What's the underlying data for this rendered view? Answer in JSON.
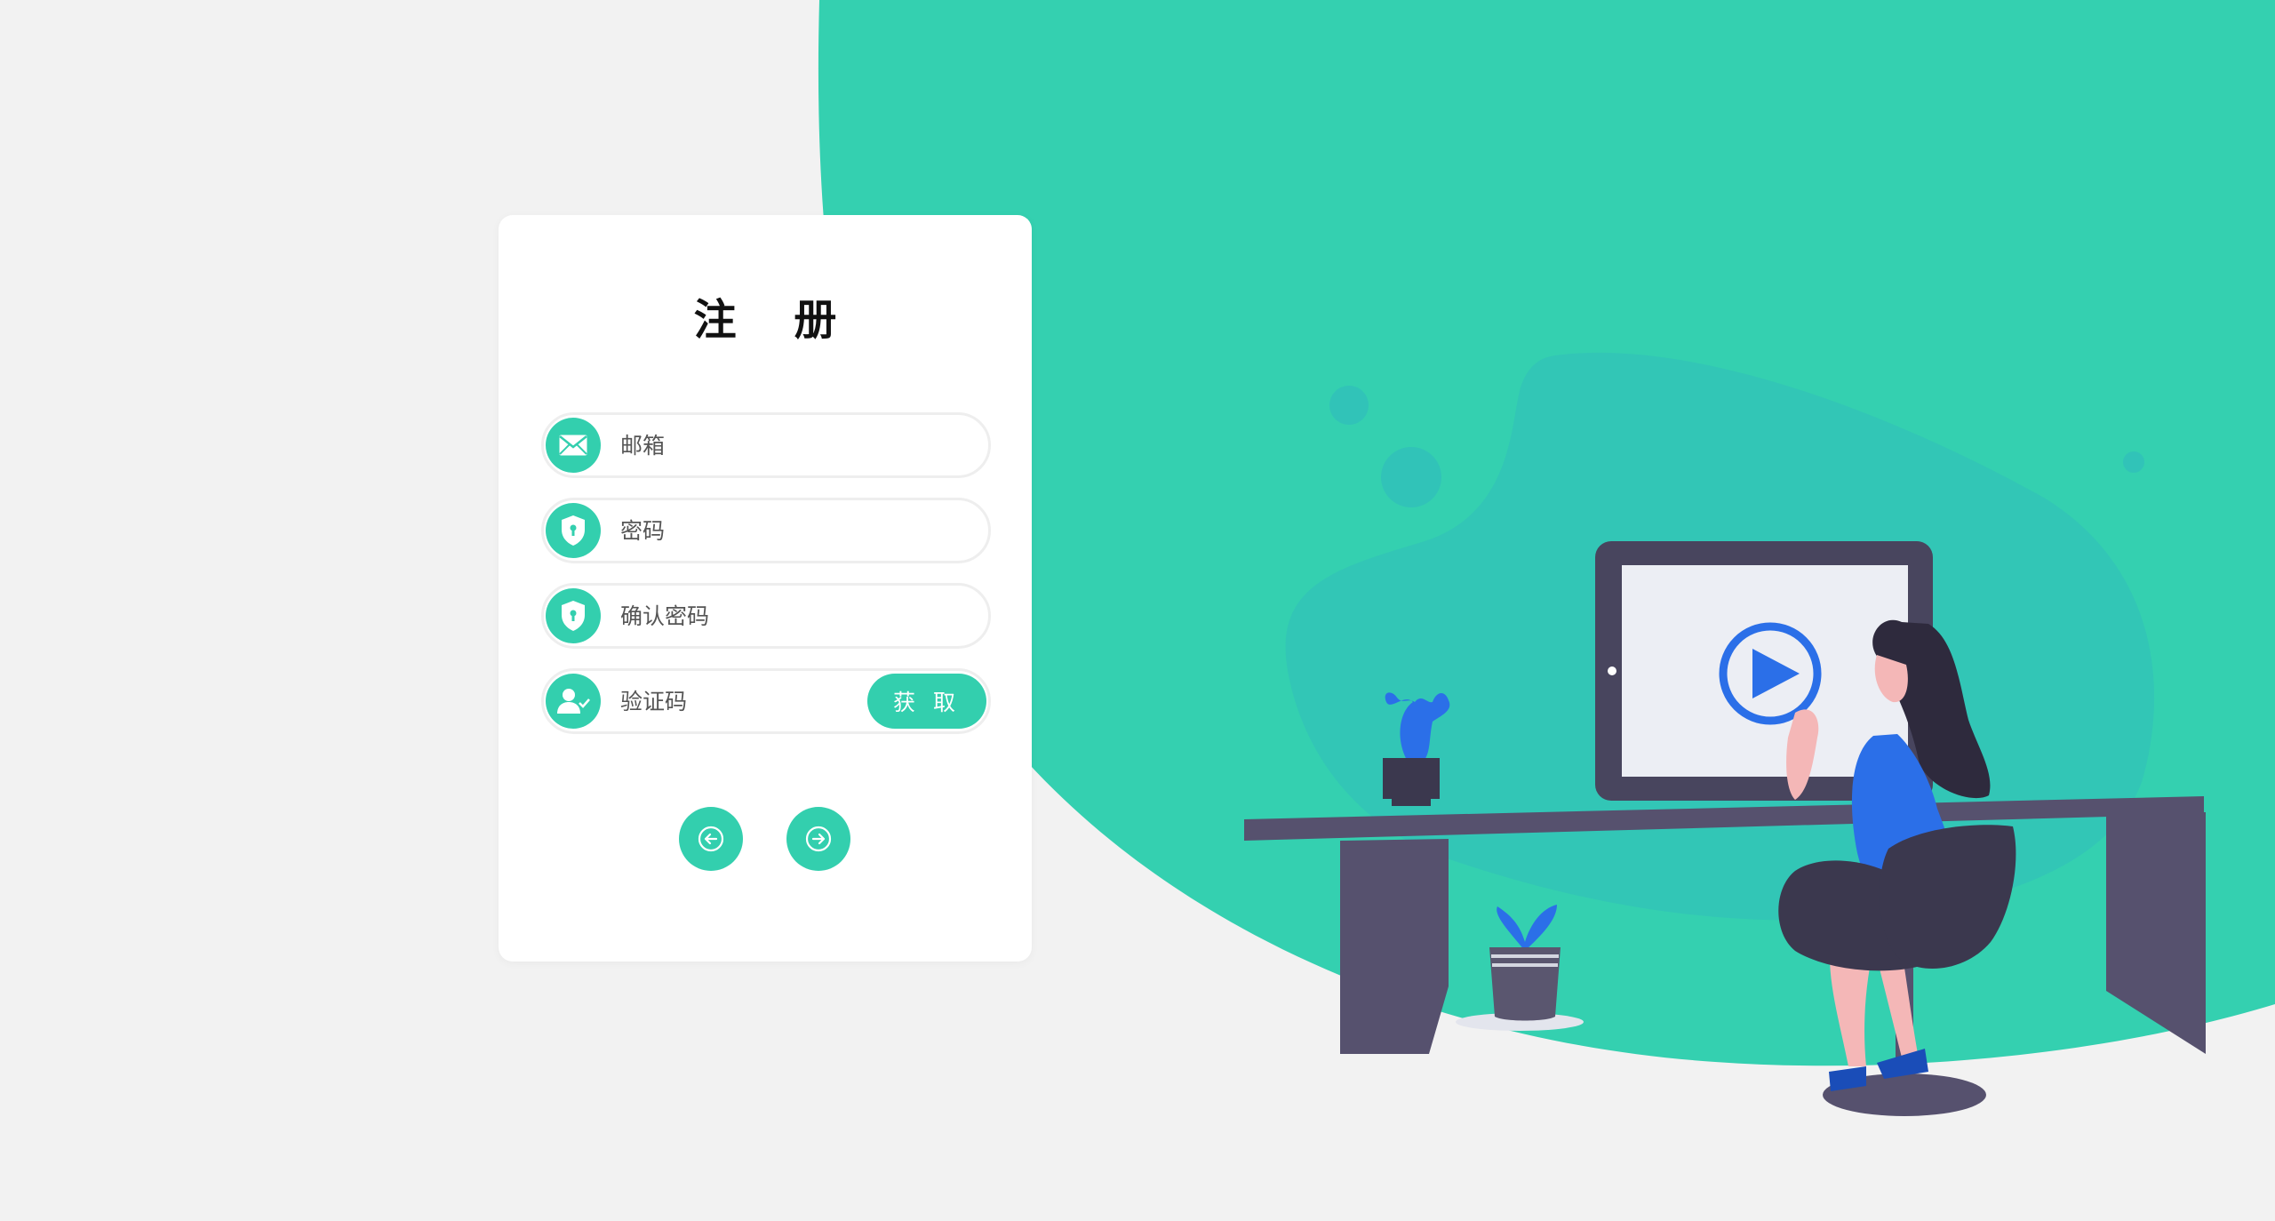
{
  "form": {
    "title": "注 册",
    "fields": {
      "email": {
        "placeholder": "邮箱",
        "icon": "envelope-icon"
      },
      "password": {
        "placeholder": "密码",
        "icon": "shield-lock-icon"
      },
      "confirm_password": {
        "placeholder": "确认密码",
        "icon": "shield-lock-icon"
      },
      "verification_code": {
        "placeholder": "验证码",
        "icon": "user-check-icon"
      }
    },
    "get_code_label": "获 取",
    "back_icon": "arrow-left-icon",
    "next_icon": "arrow-right-icon"
  },
  "colors": {
    "accent": "#33cfae",
    "background": "#f2f2f2",
    "desk": "#56516e",
    "screen_frame": "#48455e",
    "play_blue": "#2b6fe8"
  }
}
